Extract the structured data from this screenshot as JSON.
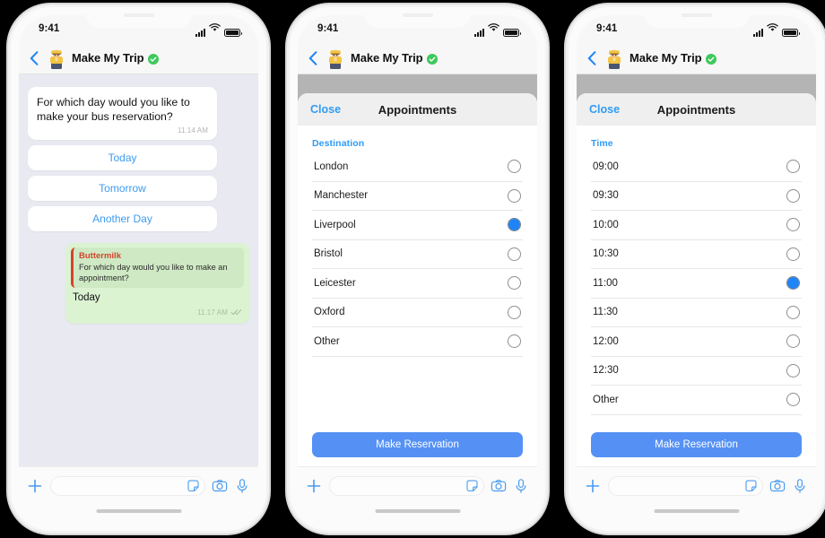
{
  "statusbar": {
    "time": "9:41",
    "signal_icon": "cellular-signal-icon",
    "wifi_icon": "wifi-icon",
    "battery_icon": "battery-icon"
  },
  "header": {
    "back_icon": "back-chevron-icon",
    "avatar_icon": "bus-driver-avatar",
    "title": "Make My Trip",
    "verified_icon": "verified-badge-icon"
  },
  "phone1": {
    "incoming": {
      "text": "For which day would you like to make your bus reservation?",
      "time": "11.14 AM"
    },
    "quick_replies": [
      {
        "label": "Today"
      },
      {
        "label": "Tomorrow"
      },
      {
        "label": "Another Day"
      }
    ],
    "outgoing": {
      "quote_author": "Buttermilk",
      "quote_text": "For which day would you like to make an appointment?",
      "text": "Today",
      "time": "11.17 AM",
      "status_icon": "double-check-icon"
    }
  },
  "phone2": {
    "sheet": {
      "close_label": "Close",
      "title": "Appointments",
      "group_label": "Destination",
      "options": [
        {
          "label": "London",
          "selected": false
        },
        {
          "label": "Manchester",
          "selected": false
        },
        {
          "label": "Liverpool",
          "selected": true
        },
        {
          "label": "Bristol",
          "selected": false
        },
        {
          "label": "Leicester",
          "selected": false
        },
        {
          "label": "Oxford",
          "selected": false
        },
        {
          "label": "Other",
          "selected": false
        }
      ],
      "cta_label": "Make Reservation"
    }
  },
  "phone3": {
    "sheet": {
      "close_label": "Close",
      "title": "Appointments",
      "group_label": "Time",
      "options": [
        {
          "label": "09:00",
          "selected": false
        },
        {
          "label": "09:30",
          "selected": false
        },
        {
          "label": "10:00",
          "selected": false
        },
        {
          "label": "10:30",
          "selected": false
        },
        {
          "label": "11:00",
          "selected": true
        },
        {
          "label": "11:30",
          "selected": false
        },
        {
          "label": "12:00",
          "selected": false
        },
        {
          "label": "12:30",
          "selected": false
        },
        {
          "label": "Other",
          "selected": false
        }
      ],
      "cta_label": "Make Reservation"
    }
  },
  "inputbar": {
    "plus_icon": "plus-icon",
    "placeholder": "",
    "value": "",
    "sticker_icon": "sticker-icon",
    "camera_icon": "camera-icon",
    "mic_icon": "microphone-icon"
  },
  "colors": {
    "accent_blue": "#2f9bf5",
    "cta_blue": "#5591f5",
    "radio_selected": "#1f84f7",
    "outgoing_bubble": "#dcf3d2",
    "quote_bar": "#d2452b",
    "chat_background": "#e9e9f2",
    "dim_backdrop": "#b4b4b4"
  }
}
